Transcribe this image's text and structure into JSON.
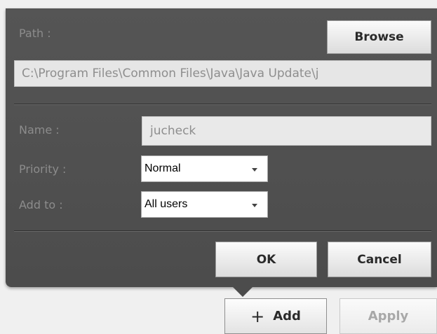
{
  "top_strip": {
    "text": ""
  },
  "dialog": {
    "path_label": "Path :",
    "browse_label": "Browse",
    "path_value": "C:\\Program Files\\Common Files\\Java\\Java Update\\j",
    "name_label": "Name :",
    "name_value": "jucheck",
    "priority_label": "Priority :",
    "priority_value": "Normal",
    "add_to_label": "Add to :",
    "add_to_value": "All users",
    "ok_label": "OK",
    "cancel_label": "Cancel"
  },
  "toolbar": {
    "add_label": "Add",
    "apply_label": "Apply"
  },
  "colors": {
    "panel_bg": "#515151",
    "label_text": "#8c8c8c",
    "field_text": "#8e8e8e",
    "disabled_text": "#a8a8a8"
  },
  "icons": {
    "add": "plus-icon",
    "select_caret": "chevron-down-icon"
  }
}
